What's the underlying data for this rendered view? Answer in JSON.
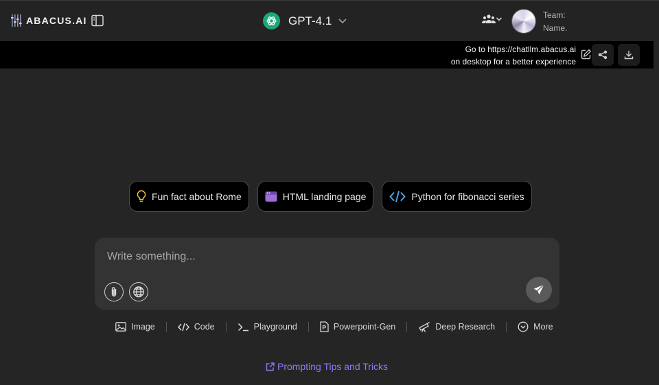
{
  "header": {
    "logo_text": "ABACUS.AI",
    "model_name": "GPT-4.1",
    "team_line1": "Team:",
    "team_line2": "Name."
  },
  "banner": {
    "line1": "Go to https://chatllm.abacus.ai",
    "line2": "on desktop for a better experience"
  },
  "suggestions": [
    {
      "label": "Fun fact about Rome",
      "icon": "lightbulb-icon"
    },
    {
      "label": "HTML landing page",
      "icon": "browser-window-icon"
    },
    {
      "label": "Python for fibonacci series",
      "icon": "code-icon"
    }
  ],
  "composer": {
    "placeholder": "Write something..."
  },
  "tools": [
    {
      "label": "Image",
      "icon": "image-icon"
    },
    {
      "label": "Code",
      "icon": "code-icon"
    },
    {
      "label": "Playground",
      "icon": "terminal-icon"
    },
    {
      "label": "Powerpoint-Gen",
      "icon": "powerpoint-icon"
    },
    {
      "label": "Deep Research",
      "icon": "telescope-icon"
    },
    {
      "label": "More",
      "icon": "chevron-circle-icon"
    }
  ],
  "footer": {
    "tips_label": "Prompting Tips and Tricks"
  },
  "colors": {
    "background": "#252525",
    "banner": "#000000",
    "composer": "#333333",
    "model_icon": "#19a97b",
    "accent_link": "#8b7cf6"
  }
}
